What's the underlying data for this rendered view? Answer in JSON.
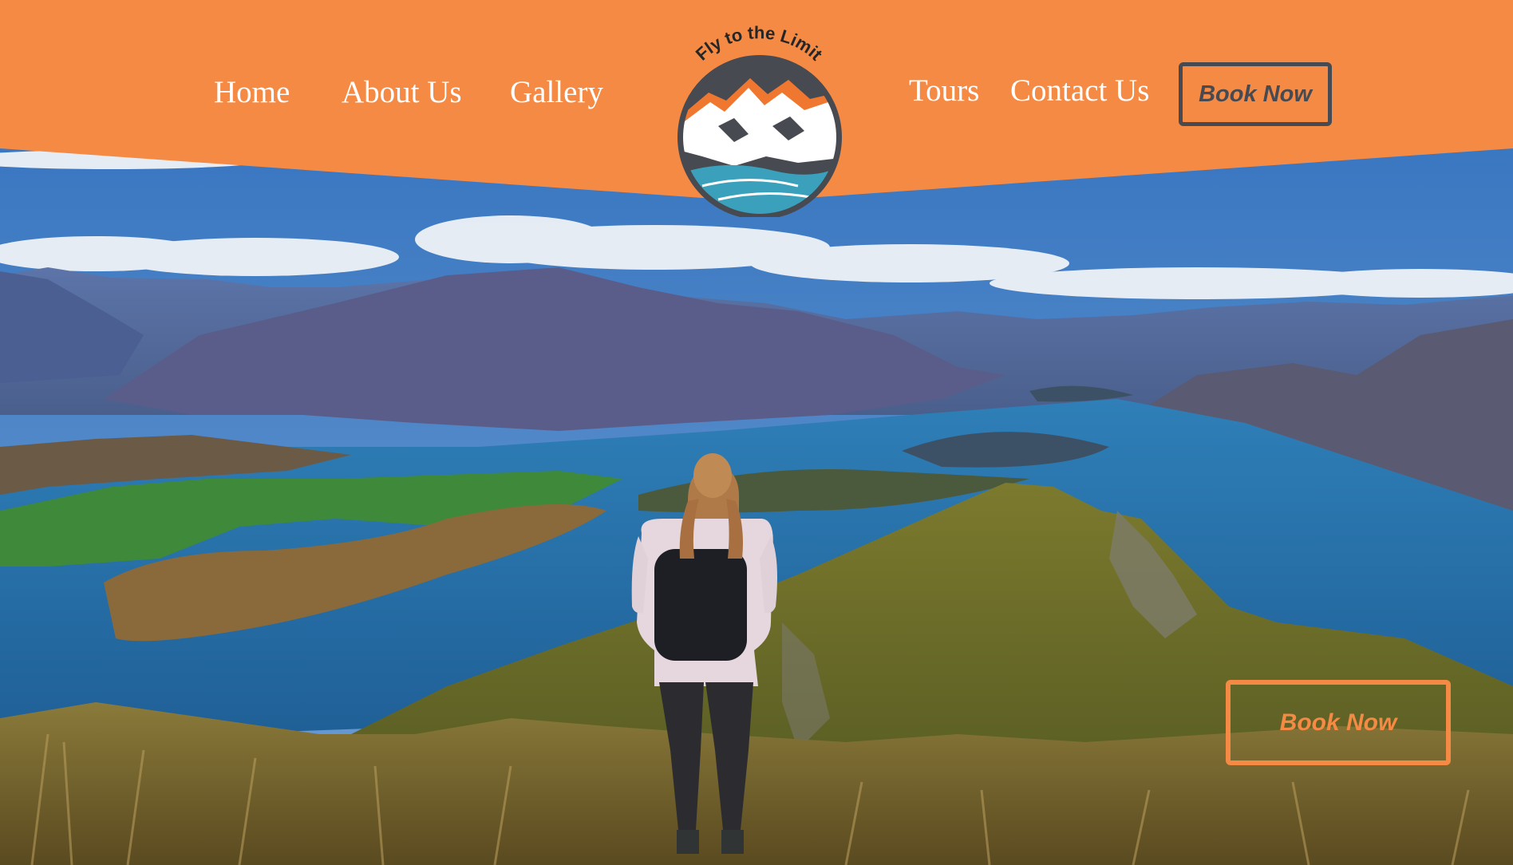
{
  "brand": {
    "name": "Fly to the Limit",
    "accent_color": "#f58a45",
    "dark_color": "#474a50",
    "logo_icon": "mountain-lake-logo-icon"
  },
  "nav": {
    "left": [
      {
        "label": "Home"
      },
      {
        "label": "About Us"
      },
      {
        "label": "Gallery"
      }
    ],
    "right": [
      {
        "label": "Tours"
      },
      {
        "label": "Contact Us"
      }
    ],
    "header_button": "Book Now"
  },
  "hero": {
    "cta_button": "Book Now",
    "scene": "hiker-overlooking-lake-and-mountains-image"
  }
}
